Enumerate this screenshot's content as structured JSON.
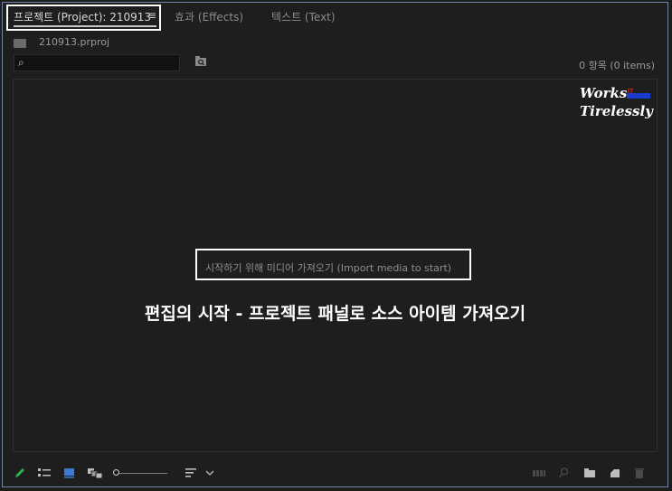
{
  "tabs": [
    {
      "label": "프로젝트 (Project): 210913",
      "menu": "≡"
    },
    {
      "label": "효과 (Effects)"
    },
    {
      "label": "텍스트 (Text)"
    }
  ],
  "project": {
    "file_name": "210913.prproj",
    "item_count": "0 항목 (0 items)"
  },
  "search": {
    "placeholder": ""
  },
  "empty_state": {
    "import_text": "시작하기 위해 미디어 가져오기 (Import media to start)"
  },
  "caption": "편집의 시작 - 프로젝트 패널로 소스 아이템 가져오기",
  "watermark": {
    "line1": "Works",
    "line2": "Tirelessly",
    "badge": "IT"
  },
  "colors": {
    "accent_blue": "#3a7bd5",
    "pen_green": "#2fb34a",
    "badge_red": "#e02020",
    "badge_blue": "#1a3ccc"
  }
}
